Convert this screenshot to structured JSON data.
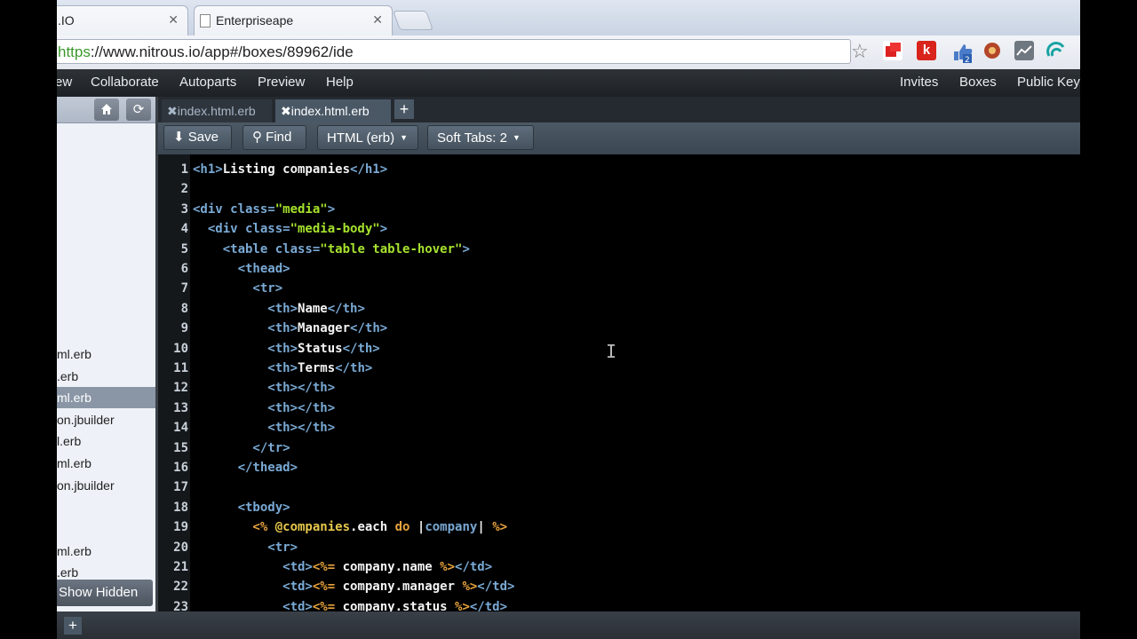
{
  "browser": {
    "tabs": [
      {
        "label": ".IO",
        "close": "✕"
      },
      {
        "label": "Enterpriseape",
        "close": "✕"
      }
    ],
    "url_scheme": "https",
    "url_rest": "://www.nitrous.io/app#/boxes/89962/ide"
  },
  "menubar": {
    "left": [
      "ew",
      "Collaborate",
      "Autoparts",
      "Preview",
      "Help"
    ],
    "right": [
      "Invites",
      "Boxes",
      "Public Key"
    ]
  },
  "sidebar": {
    "files": [
      {
        "label": "ml.erb"
      },
      {
        "label": ".erb"
      },
      {
        "label": "ml.erb",
        "selected": true
      },
      {
        "label": "on.jbuilder"
      },
      {
        "label": "l.erb"
      },
      {
        "label": "ml.erb"
      },
      {
        "label": "on.jbuilder"
      },
      {
        "label": "ml.erb"
      },
      {
        "label": ".erb"
      }
    ],
    "show_hidden": "Show Hidden"
  },
  "editor": {
    "tabs": [
      {
        "label": "index.html.erb",
        "active": false
      },
      {
        "label": "index.html.erb",
        "active": true
      }
    ],
    "toolbar": {
      "save": "Save",
      "find": "Find",
      "mode": "HTML (erb)",
      "tabs": "Soft Tabs: 2"
    },
    "lines": [
      [
        {
          "c": "t-tag",
          "t": "<h1>"
        },
        {
          "c": "t-txt",
          "t": "Listing companies"
        },
        {
          "c": "t-tag",
          "t": "</h1>"
        }
      ],
      [],
      [
        {
          "c": "t-tag",
          "t": "<div class="
        },
        {
          "c": "t-str",
          "t": "\"media\""
        },
        {
          "c": "t-tag",
          "t": ">"
        }
      ],
      [
        {
          "c": "t-tag",
          "t": "  <div class="
        },
        {
          "c": "t-str",
          "t": "\"media-body\""
        },
        {
          "c": "t-tag",
          "t": ">"
        }
      ],
      [
        {
          "c": "t-tag",
          "t": "    <table class="
        },
        {
          "c": "t-str",
          "t": "\"table table-hover\""
        },
        {
          "c": "t-tag",
          "t": ">"
        }
      ],
      [
        {
          "c": "t-tag",
          "t": "      <thead>"
        }
      ],
      [
        {
          "c": "t-tag",
          "t": "        <tr>"
        }
      ],
      [
        {
          "c": "t-tag",
          "t": "          <th>"
        },
        {
          "c": "t-txt",
          "t": "Name"
        },
        {
          "c": "t-tag",
          "t": "</th>"
        }
      ],
      [
        {
          "c": "t-tag",
          "t": "          <th>"
        },
        {
          "c": "t-txt",
          "t": "Manager"
        },
        {
          "c": "t-tag",
          "t": "</th>"
        }
      ],
      [
        {
          "c": "t-tag",
          "t": "          <th>"
        },
        {
          "c": "t-txt",
          "t": "Status"
        },
        {
          "c": "t-tag",
          "t": "</th>"
        }
      ],
      [
        {
          "c": "t-tag",
          "t": "          <th>"
        },
        {
          "c": "t-txt",
          "t": "Terms"
        },
        {
          "c": "t-tag",
          "t": "</th>"
        }
      ],
      [
        {
          "c": "t-tag",
          "t": "          <th></th>"
        }
      ],
      [
        {
          "c": "t-tag",
          "t": "          <th></th>"
        }
      ],
      [
        {
          "c": "t-tag",
          "t": "          <th></th>"
        }
      ],
      [
        {
          "c": "t-tag",
          "t": "        </tr>"
        }
      ],
      [
        {
          "c": "t-tag",
          "t": "      </thead>"
        }
      ],
      [],
      [
        {
          "c": "t-tag",
          "t": "      <tbody>"
        }
      ],
      [
        {
          "c": "t-erb",
          "t": "        <% "
        },
        {
          "c": "t-ivar",
          "t": "@companies"
        },
        {
          "c": "t-txt",
          "t": ".each "
        },
        {
          "c": "t-kw",
          "t": "do"
        },
        {
          "c": "t-txt",
          "t": " |"
        },
        {
          "c": "t-blk",
          "t": "company"
        },
        {
          "c": "t-txt",
          "t": "| "
        },
        {
          "c": "t-erb",
          "t": "%>"
        }
      ],
      [
        {
          "c": "t-tag",
          "t": "          <tr>"
        }
      ],
      [
        {
          "c": "t-tag",
          "t": "            <td>"
        },
        {
          "c": "t-erb",
          "t": "<%= "
        },
        {
          "c": "t-txt",
          "t": "company.name "
        },
        {
          "c": "t-erb",
          "t": "%>"
        },
        {
          "c": "t-tag",
          "t": "</td>"
        }
      ],
      [
        {
          "c": "t-tag",
          "t": "            <td>"
        },
        {
          "c": "t-erb",
          "t": "<%= "
        },
        {
          "c": "t-txt",
          "t": "company.manager "
        },
        {
          "c": "t-erb",
          "t": "%>"
        },
        {
          "c": "t-tag",
          "t": "</td>"
        }
      ],
      [
        {
          "c": "t-tag",
          "t": "            <td>"
        },
        {
          "c": "t-erb",
          "t": "<%= "
        },
        {
          "c": "t-txt",
          "t": "company.status "
        },
        {
          "c": "t-erb",
          "t": "%>"
        },
        {
          "c": "t-tag",
          "t": "</td>"
        }
      ]
    ]
  }
}
